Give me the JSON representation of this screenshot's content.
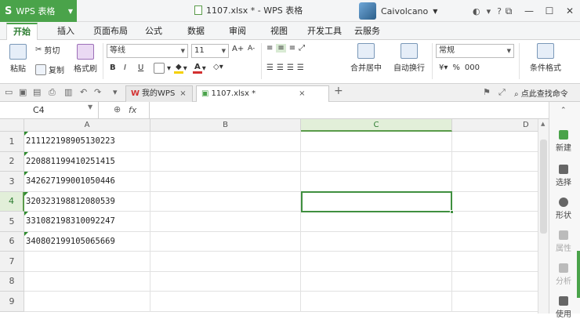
{
  "app": {
    "name": "WPS 表格",
    "logo": "S"
  },
  "window_title": "1107.xlsx * - WPS 表格",
  "user": {
    "name": "Caivolcano"
  },
  "menu": [
    "开始",
    "插入",
    "页面布局",
    "公式",
    "数据",
    "审阅",
    "视图",
    "开发工具",
    "云服务"
  ],
  "ribbon": {
    "paste": "粘贴",
    "cut": "剪切",
    "copy": "复制",
    "format_painter": "格式刷",
    "font_name": "等线",
    "font_size": "11",
    "merge_center": "合并居中",
    "wrap_text": "自动换行",
    "number_format": "常规",
    "conditional_format": "条件格式",
    "bold": "B",
    "italic": "I",
    "underline": "U",
    "percent": "%",
    "thousands": "000",
    "grow_font": "A+",
    "shrink_font": "A-"
  },
  "tabs": [
    {
      "label": "我的WPS"
    },
    {
      "label": "1107.xlsx *"
    }
  ],
  "search_placeholder": "点此查找命令",
  "name_box": "C4",
  "fx": "fx",
  "columns": [
    "A",
    "B",
    "C",
    "D"
  ],
  "rows": [
    "1",
    "2",
    "3",
    "4",
    "5",
    "6",
    "7",
    "8",
    "9"
  ],
  "cells_a": [
    "211122198905130223",
    "220881199410251415",
    "342627199001050446",
    "320323198812080539",
    "331082198310092247",
    "340802199105065669"
  ],
  "side_panel": [
    {
      "label": "新建"
    },
    {
      "label": "选择"
    },
    {
      "label": "形状"
    },
    {
      "label": "属性"
    },
    {
      "label": "分析"
    },
    {
      "label": "使用"
    }
  ],
  "colors": {
    "accent": "#4aa34a"
  }
}
